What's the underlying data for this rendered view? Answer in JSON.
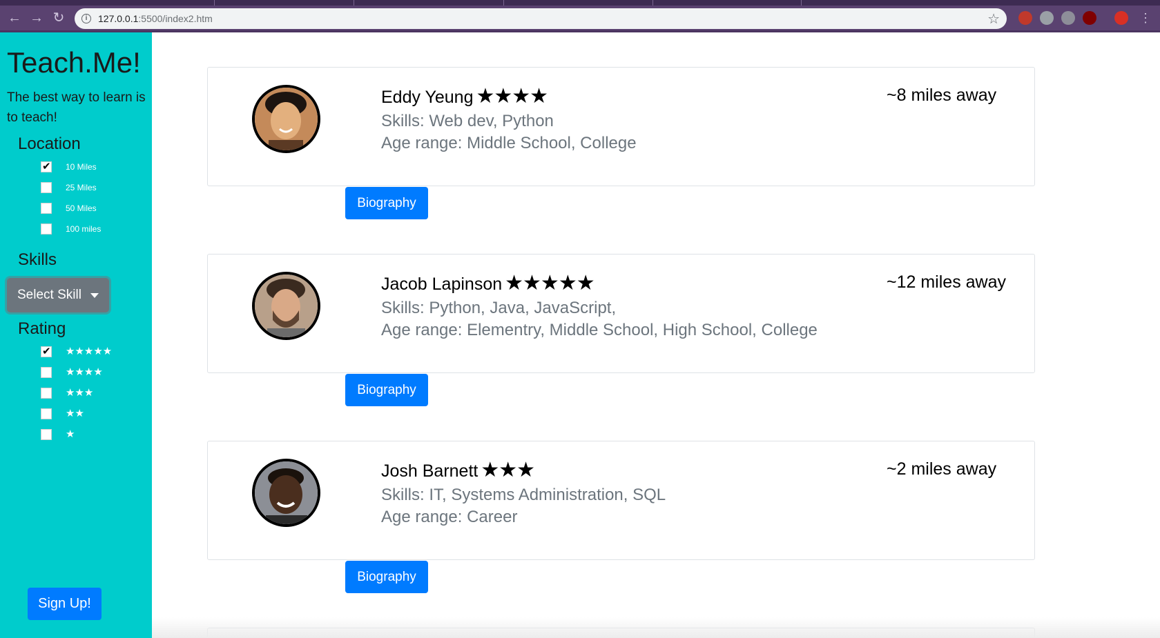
{
  "browser": {
    "url_host": "127.0.0.1",
    "url_rest": ":5500/index2.htm"
  },
  "sidebar": {
    "brand": "Teach.Me!",
    "tagline": "The best way to learn is to teach!",
    "location": {
      "title": "Location",
      "options": [
        {
          "label": "10 Miles",
          "checked": true
        },
        {
          "label": "25 Miles",
          "checked": false
        },
        {
          "label": "50 Miles",
          "checked": false
        },
        {
          "label": "100 miles",
          "checked": false
        }
      ]
    },
    "skills": {
      "title": "Skills",
      "dropdown_label": "Select Skill"
    },
    "rating": {
      "title": "Rating",
      "options": [
        {
          "stars": "★★★★★",
          "checked": true
        },
        {
          "stars": "★★★★",
          "checked": false
        },
        {
          "stars": "★★★",
          "checked": false
        },
        {
          "stars": "★★",
          "checked": false
        },
        {
          "stars": "★",
          "checked": false
        }
      ]
    },
    "signup_label": "Sign Up!"
  },
  "tutors": [
    {
      "name": "Eddy Yeung",
      "stars": "★★★★",
      "skills": "Skills: Web dev, Python",
      "ages": "Age range: Middle School, College",
      "distance": "~8 miles away",
      "bio_label": "Biography"
    },
    {
      "name": "Jacob Lapinson",
      "stars": "★★★★★",
      "skills": "Skills: Python, Java, JavaScript,",
      "ages": "Age range: Elementry, Middle School, High School, College",
      "distance": "~12 miles away",
      "bio_label": "Biography"
    },
    {
      "name": "Josh Barnett",
      "stars": "★★★",
      "skills": "Skills: IT, Systems Administration, SQL",
      "ages": "Age range: Career",
      "distance": "~2 miles away",
      "bio_label": "Biography"
    }
  ]
}
